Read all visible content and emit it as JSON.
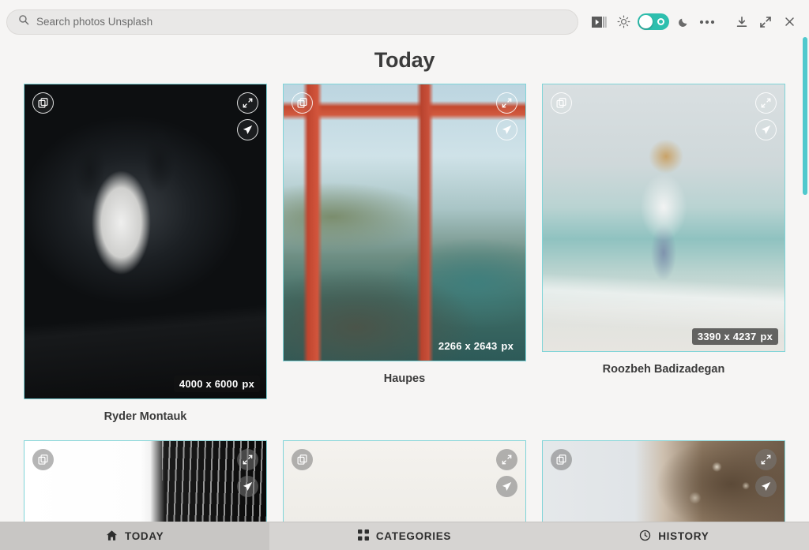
{
  "window": {
    "title": "Today"
  },
  "search": {
    "placeholder": "Search photos Unsplash",
    "value": "",
    "icon": "search-icon"
  },
  "toolbar": {
    "buttons": [
      {
        "name": "panel-toggle-icon",
        "label": "Panel"
      },
      {
        "name": "sun-icon",
        "label": "Light"
      },
      {
        "name": "theme-toggle",
        "label": "Theme toggle",
        "state": "on",
        "color": "#2dbfae"
      },
      {
        "name": "moon-icon",
        "label": "Dark"
      },
      {
        "name": "more-menu-icon",
        "label": "More"
      },
      {
        "name": "download-icon",
        "label": "Download"
      },
      {
        "name": "fullscreen-icon",
        "label": "Fullscreen"
      },
      {
        "name": "close-icon",
        "label": "Close"
      }
    ]
  },
  "main": {
    "heading": "Today",
    "card_icons": {
      "copy": "copy-icon",
      "expand": "expand-icon",
      "send": "send-icon"
    },
    "cards": [
      {
        "author": "Ryder Montauk",
        "resolution": "4000 x 6000",
        "unit": "px",
        "photo": "ph-dog",
        "badge_shaded": true,
        "height_class": "h1"
      },
      {
        "author": "Haupes",
        "resolution": "2266 x 2643",
        "unit": "px",
        "photo": "ph-bridge",
        "badge_shaded": false,
        "height_class": "h2"
      },
      {
        "author": "Roozbeh Badizadegan",
        "resolution": "3390 x 4237",
        "unit": "px",
        "photo": "ph-beach",
        "badge_shaded": true,
        "height_class": "h3"
      },
      {
        "author": "",
        "resolution": "",
        "unit": "",
        "photo": "ph-arch",
        "badge_shaded": false,
        "height_class": "row2"
      },
      {
        "author": "",
        "resolution": "",
        "unit": "",
        "photo": "ph-plain",
        "badge_shaded": false,
        "height_class": "row2"
      },
      {
        "author": "",
        "resolution": "",
        "unit": "",
        "photo": "ph-tree",
        "badge_shaded": false,
        "height_class": "row2"
      }
    ]
  },
  "bottom_nav": {
    "items": [
      {
        "label": "TODAY",
        "icon": "home-icon",
        "active": true
      },
      {
        "label": "CATEGORIES",
        "icon": "grid-icon",
        "active": false
      },
      {
        "label": "HISTORY",
        "icon": "clock-icon",
        "active": false
      }
    ]
  },
  "colors": {
    "accent": "#2dbfae",
    "card_border": "#7fd4d8",
    "scrollbar": "#4fc9cd",
    "chrome": "#f6f5f4",
    "nav_bg": "#d6d4d2"
  }
}
